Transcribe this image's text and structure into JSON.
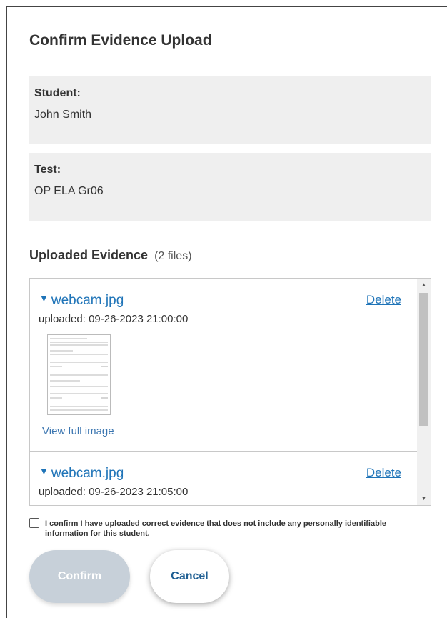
{
  "dialog": {
    "title": "Confirm Evidence Upload",
    "student": {
      "label": "Student:",
      "value": "John Smith"
    },
    "test": {
      "label": "Test:",
      "value": "OP ELA Gr06"
    },
    "evidence": {
      "heading": "Uploaded Evidence",
      "count_text": "(2 files)",
      "items": [
        {
          "expand_icon": "triangle-down-icon",
          "file_name": "webcam.jpg",
          "uploaded": "uploaded: 09-26-2023 21:00:00",
          "delete_label": "Delete",
          "view_full_label": "View full image"
        },
        {
          "expand_icon": "triangle-down-icon",
          "file_name": "webcam.jpg",
          "uploaded": "uploaded: 09-26-2023 21:05:00",
          "delete_label": "Delete"
        }
      ]
    },
    "confirm_text": "I confirm I have uploaded correct evidence that does not include any personally identifiable information for this student.",
    "buttons": {
      "confirm": "Confirm",
      "cancel": "Cancel"
    },
    "colors": {
      "link": "#1f74b8",
      "panel": "#efefef",
      "confirm_disabled": "#c7d0d9"
    }
  }
}
